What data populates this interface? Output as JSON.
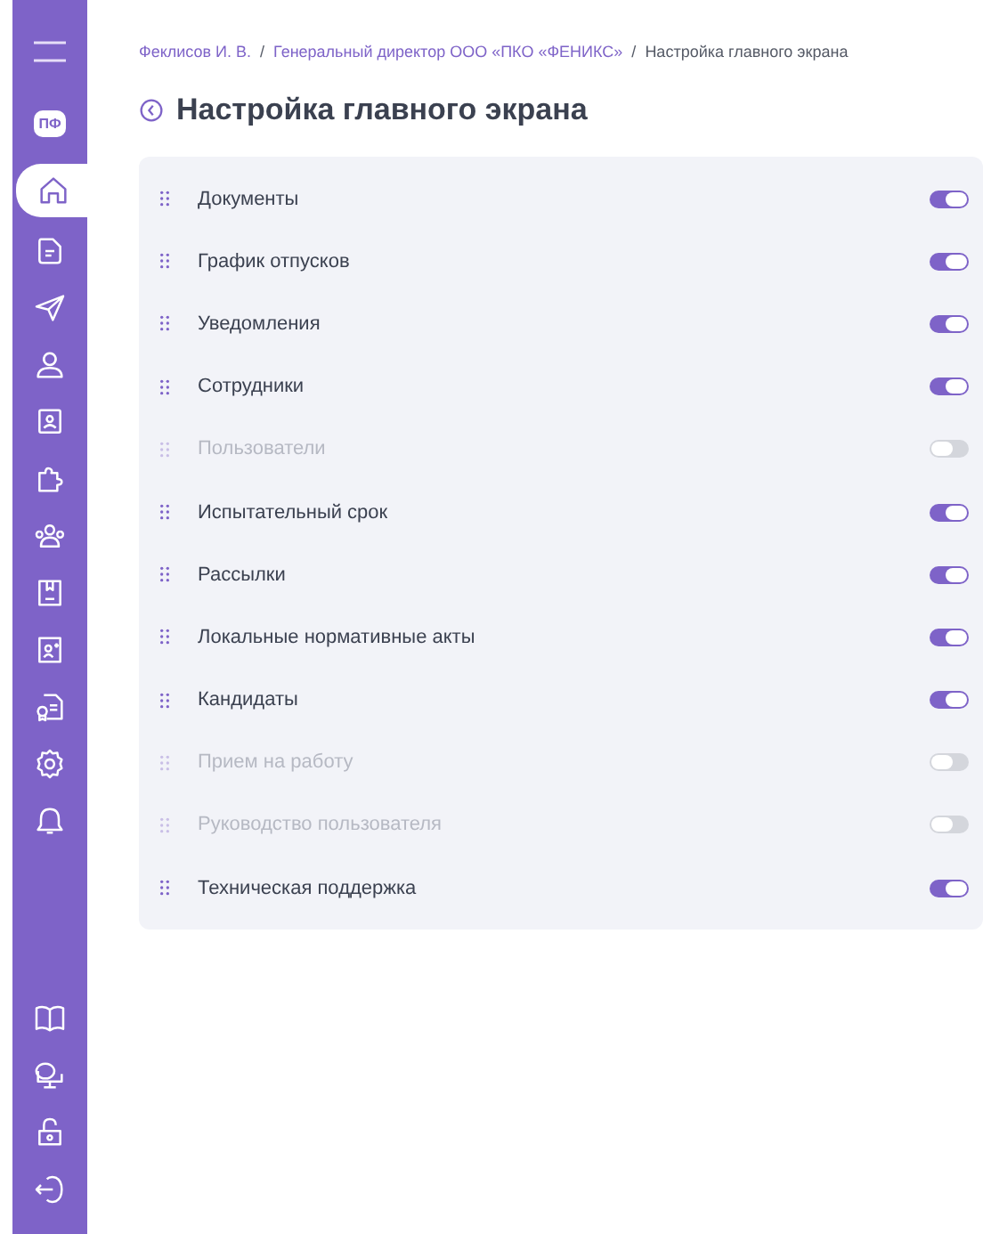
{
  "sidebar": {
    "badge": "ПФ",
    "items": [
      {
        "selected": true
      },
      {
        "selected": false
      },
      {
        "selected": false
      },
      {
        "selected": false
      },
      {
        "selected": false
      },
      {
        "selected": false
      },
      {
        "selected": false
      },
      {
        "selected": false
      },
      {
        "selected": false
      },
      {
        "selected": false
      },
      {
        "selected": false
      },
      {
        "selected": false
      }
    ],
    "bottom_items": [
      {
        "selected": false
      },
      {
        "selected": false
      },
      {
        "selected": false
      },
      {
        "selected": false
      }
    ]
  },
  "breadcrumb_separator": "/",
  "breadcrumbs": [
    "Феклисов И. В.",
    "Генеральный директор ООО «ПКО «ФЕНИКС»",
    "Настройка главного экрана"
  ],
  "title": "Настройка главного экрана",
  "settings": [
    {
      "label": "Документы",
      "on": true
    },
    {
      "label": "График отпусков",
      "on": true
    },
    {
      "label": "Уведомления",
      "on": true
    },
    {
      "label": "Сотрудники",
      "on": true
    },
    {
      "label": "Пользователи",
      "on": false
    },
    {
      "label": "Испытательный срок",
      "on": true
    },
    {
      "label": "Рассылки",
      "on": true
    },
    {
      "label": "Локальные нормативные акты",
      "on": true
    },
    {
      "label": "Кандидаты",
      "on": true
    },
    {
      "label": "Прием на работу",
      "on": false
    },
    {
      "label": "Руководство пользователя",
      "on": false
    },
    {
      "label": "Техническая поддержка",
      "on": true
    }
  ]
}
